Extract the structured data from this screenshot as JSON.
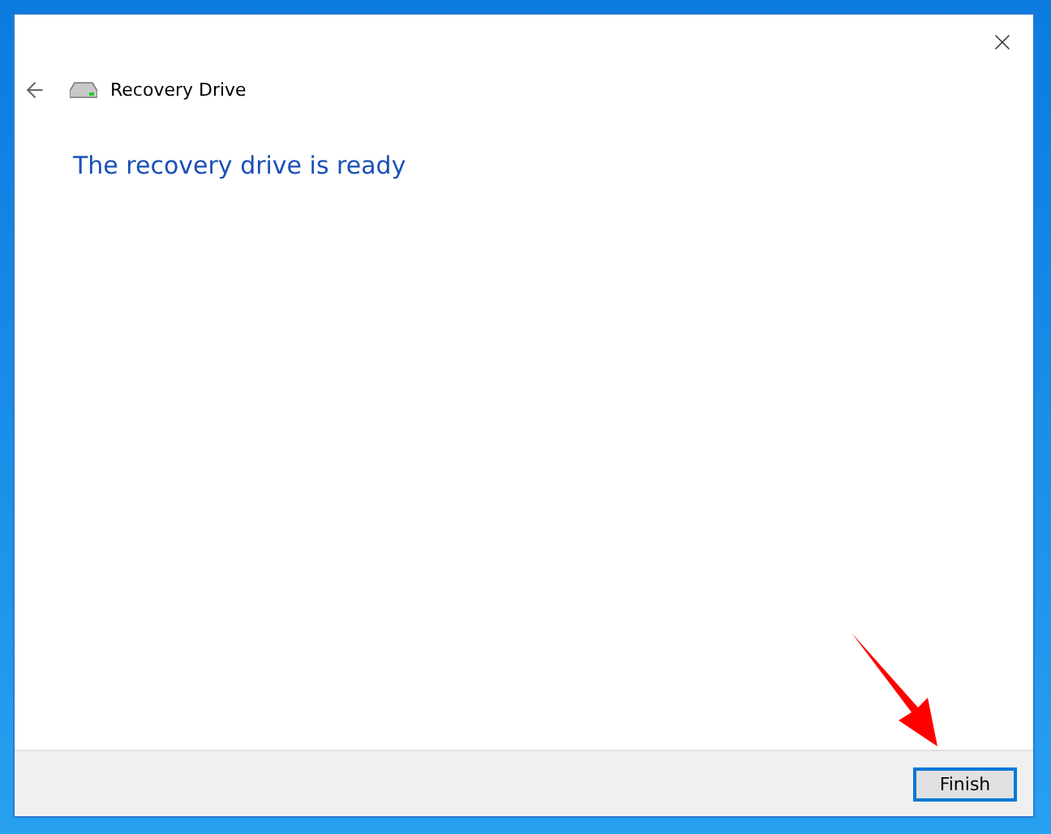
{
  "window": {
    "title": "Recovery Drive"
  },
  "heading": "The recovery drive is ready",
  "buttons": [
    {
      "label": "Finish",
      "focused": true
    }
  ]
}
